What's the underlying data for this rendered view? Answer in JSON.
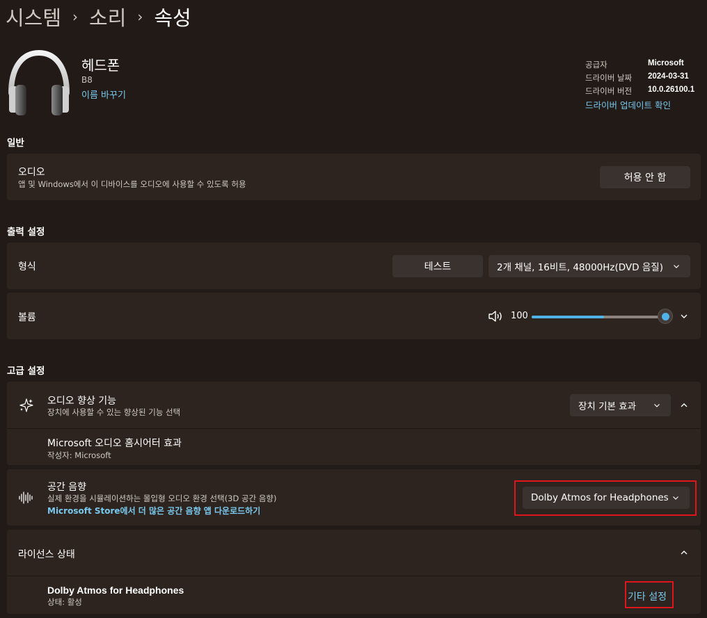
{
  "breadcrumb": {
    "items": [
      "시스템",
      "소리",
      "속성"
    ],
    "separator": "›"
  },
  "device": {
    "name": "헤드폰",
    "subtitle": "B8",
    "rename_link": "이름 바꾸기",
    "icon": "headphones-icon"
  },
  "driver_info": {
    "rows": [
      {
        "label": "공급자",
        "value": "Microsoft"
      },
      {
        "label": "드라이버 날짜",
        "value": "2024-03-31"
      },
      {
        "label": "드라이버 버전",
        "value": "10.0.26100.1"
      }
    ],
    "update_link": "드라이버 업데이트 확인"
  },
  "general": {
    "section_title": "일반",
    "audio": {
      "title": "오디오",
      "description": "앱 및 Windows에서 이 디바이스를 오디오에 사용할 수 있도록 허용",
      "button_label": "허용 안 함"
    }
  },
  "output": {
    "section_title": "출력 설정",
    "format": {
      "title": "형식",
      "test_button": "테스트",
      "selected": "2개 채널, 16비트, 48000Hz(DVD 음질)"
    },
    "volume": {
      "title": "볼륨",
      "icon": "speaker-icon",
      "value": "100",
      "level": 1.0
    }
  },
  "advanced": {
    "section_title": "고급 설정",
    "enhancements": {
      "icon": "sparkle-icon",
      "title": "오디오 향상 기능",
      "description": "장치에 사용할 수 있는 향상된 기능 선택",
      "selected": "장치 기본 효과"
    },
    "home_theater": {
      "title": "Microsoft 오디오 홈시어터 효과",
      "author": "작성자: Microsoft"
    },
    "spatial": {
      "icon": "sound-wave-icon",
      "title": "공간 음향",
      "description": "실제 환경을 시뮬레이션하는 몰입형 오디오 환경 선택(3D 공간 음향)",
      "store_link": "Microsoft Store에서 더 많은 공간 음향 앱 다운로드하기",
      "selected": "Dolby Atmos for Headphones"
    },
    "license": {
      "title": "라이선스 상태",
      "product": "Dolby Atmos for Headphones",
      "status": "상태: 활성",
      "more_link": "기타 설정"
    }
  },
  "colors": {
    "background": "#221a16",
    "card": "#2d2420",
    "accent": "#4fb3e8",
    "link": "#79c9ee",
    "highlight": "#e0141b"
  }
}
